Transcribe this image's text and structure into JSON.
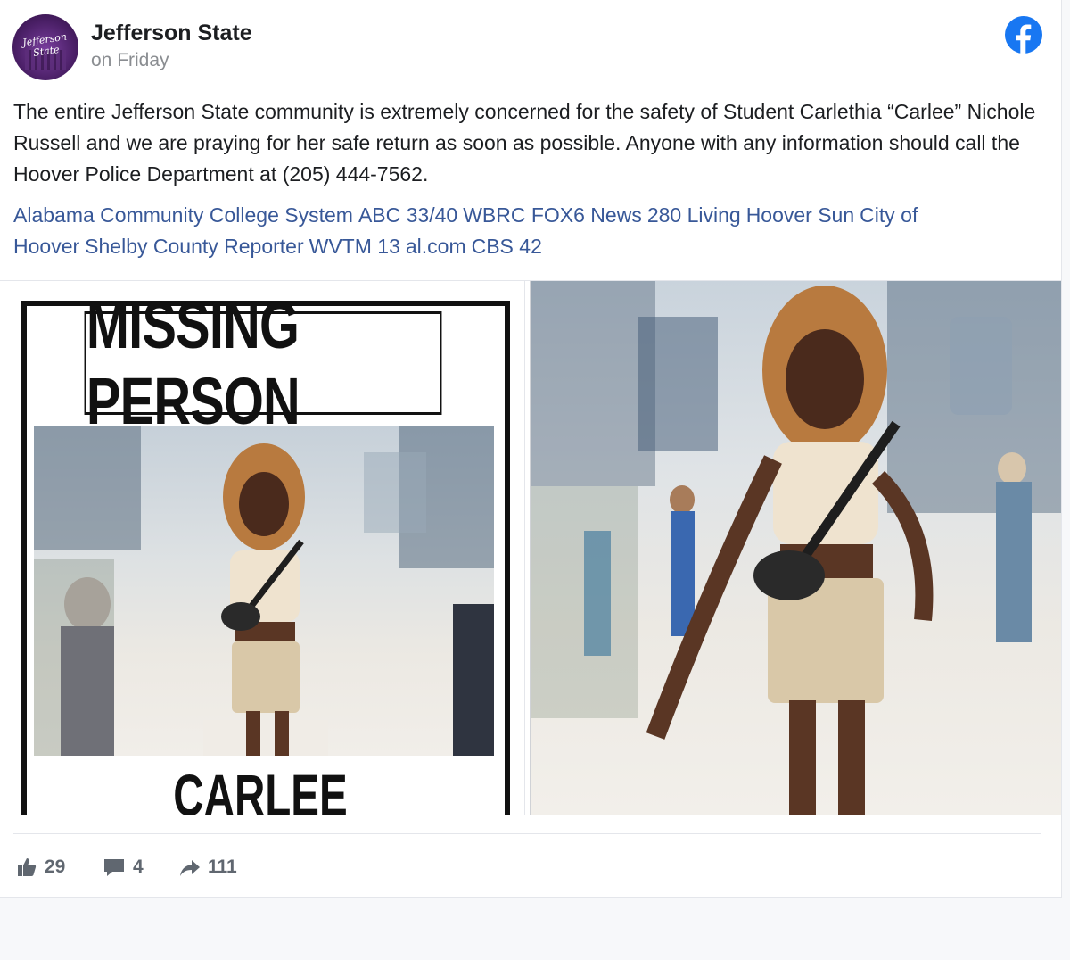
{
  "post": {
    "page_name": "Jefferson State",
    "timestamp": "on Friday",
    "avatar_text": "Jefferson State",
    "body": "The entire Jefferson State community is extremely concerned for the safety of Student Carlethia “Carlee” Nichole Russell and we are praying for her safe return as soon as possible. Anyone with any information should call the Hoover Police Department at (205) 444-7562.",
    "tags": [
      "Alabama Community College System",
      "ABC 33/40",
      "WBRC FOX6 News",
      "280 Living",
      "Hoover Sun",
      "City of Hoover",
      "Shelby County Reporter",
      "WVTM 13",
      "al.com",
      "CBS 42"
    ]
  },
  "poster": {
    "title": "MISSING PERSON",
    "name": "CARLEE RUSSELL"
  },
  "engagement": {
    "likes": "29",
    "comments": "4",
    "shares": "111"
  },
  "icons": {
    "facebook": "facebook-logo-icon",
    "like": "thumbs-up-icon",
    "comment": "comment-bubble-icon",
    "share": "share-arrow-icon"
  },
  "colors": {
    "facebook_blue": "#1877f2",
    "link": "#385898",
    "muted": "#8a8d91",
    "engagement": "#606770",
    "avatar_purple": "#4a1f66"
  }
}
